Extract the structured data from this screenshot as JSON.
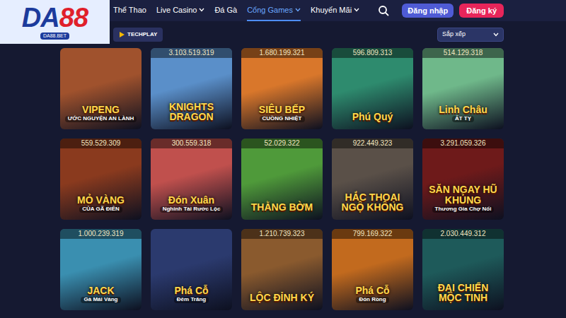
{
  "logo": {
    "part1": "DA",
    "part2": "88",
    "subtitle": "DA88.BET"
  },
  "nav": [
    {
      "label": "Thể Thao",
      "has_menu": false,
      "selected": false
    },
    {
      "label": "Live Casino",
      "has_menu": true,
      "selected": false
    },
    {
      "label": "Đá Gà",
      "has_menu": false,
      "selected": false
    },
    {
      "label": "Cổng Games",
      "has_menu": true,
      "selected": true
    },
    {
      "label": "Khuyến Mãi",
      "has_menu": true,
      "selected": false
    }
  ],
  "auth": {
    "login": "Đăng nhập",
    "register": "Đăng ký"
  },
  "filters": {
    "provider": "TECHPLAY",
    "sort": "Sắp xếp"
  },
  "games": [
    {
      "title": "VIPENG",
      "subtitle": "ƯỚC NGUYỆN AN LÀNH",
      "color": "#a0522d"
    },
    {
      "title": "KNIGHTS DRAGON",
      "jackpot": "3.103.519.319",
      "color": "#5a8fc9"
    },
    {
      "title": "SIÊU BẾP",
      "subtitle": "CUỒNG NHIỆT",
      "jackpot": "1.680.199.321",
      "color": "#d9772b"
    },
    {
      "title": "Phú Quý",
      "jackpot": "596.809.313",
      "color": "#2e8b6e"
    },
    {
      "title": "Linh Châu",
      "subtitle": "ẤT TỴ",
      "jackpot": "514.129.318",
      "color": "#6fb88a"
    },
    {
      "title": "MỎ VÀNG",
      "subtitle": "CỦA GÃ ĐIÊN",
      "jackpot": "559.529.309",
      "color": "#8a3a1e"
    },
    {
      "title": "Đón Xuân",
      "subtitle": "Nghinh Tài Rước Lộc",
      "jackpot": "300.559.318",
      "color": "#c0504d"
    },
    {
      "title": "THẰNG BỜM",
      "jackpot": "52.029.322",
      "color": "#4f9a3a"
    },
    {
      "title": "HẮC THOẠI NGỘ KHÔNG",
      "jackpot": "922.449.323",
      "color": "#5a5048"
    },
    {
      "title": "SĂN NGAY HŨ KHỦNG",
      "subtitle": "Thương Gia Chợ Nổi",
      "jackpot": "3.291.059.326",
      "color": "#6e1a1a"
    },
    {
      "title": "JACK",
      "subtitle": "Gà Mái Vàng",
      "jackpot": "1.000.239.319",
      "color": "#3a8fb0"
    },
    {
      "title": "Phá Cỗ",
      "subtitle": "Đêm Trăng",
      "color": "#2b3a6e"
    },
    {
      "title": "LỘC ĐỈNH KÝ",
      "jackpot": "1.210.739.323",
      "color": "#8a5a2e"
    },
    {
      "title": "Phá Cỗ",
      "subtitle": "Đón Rồng",
      "jackpot": "799.169.322",
      "color": "#c26a1e"
    },
    {
      "title": "ĐẠI CHIẾN MỘC TINH",
      "jackpot": "2.030.449.312",
      "color": "#1e5a5a"
    }
  ]
}
